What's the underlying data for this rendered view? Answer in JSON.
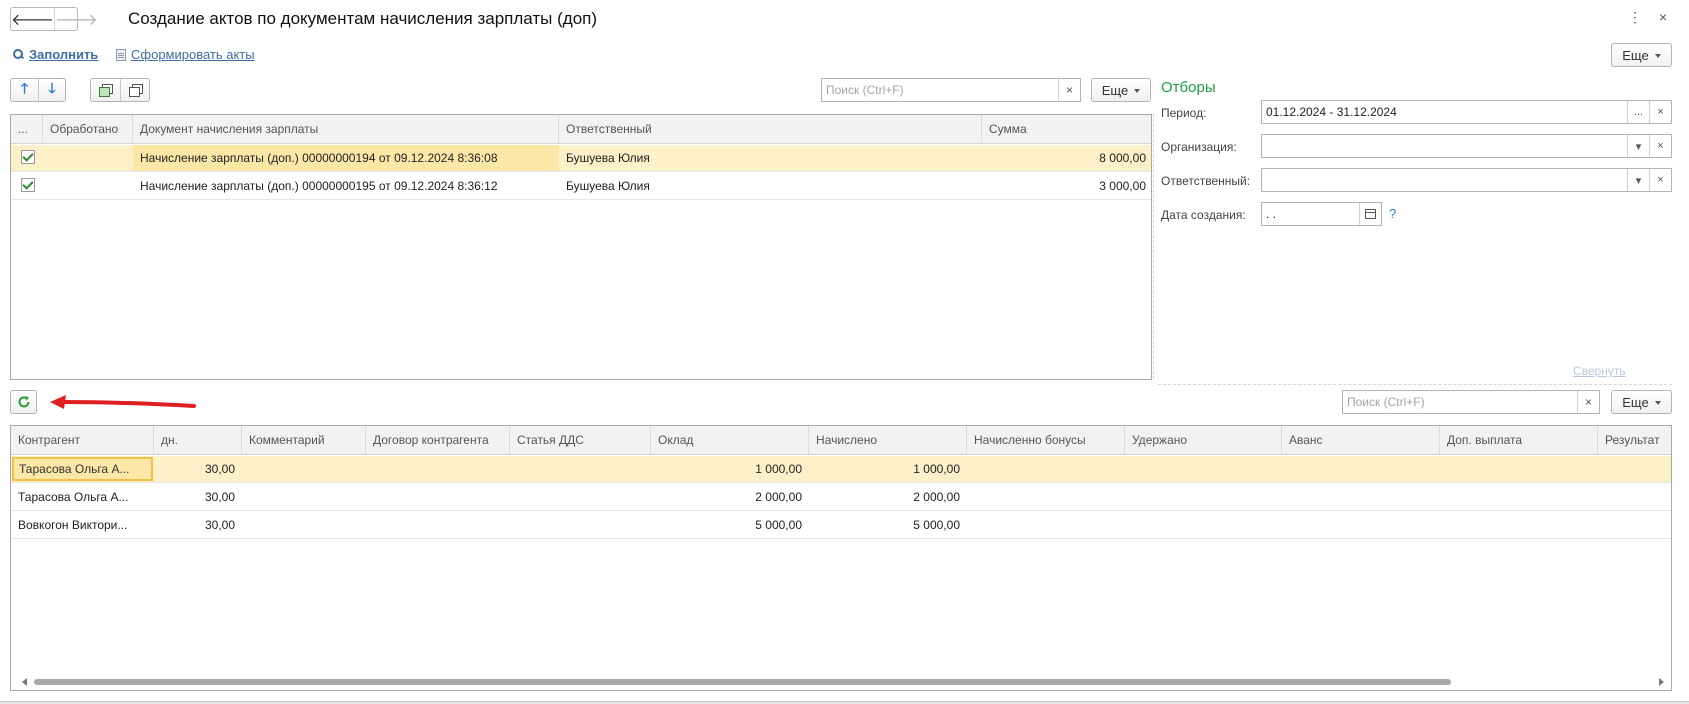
{
  "window": {
    "title": "Создание актов по документам начисления зарплаты (доп)",
    "nav_back": "🡐",
    "nav_forward": "🡒",
    "menu_icon": "⋮",
    "close_icon": "×"
  },
  "commands": {
    "fill": "Заполнить",
    "form_acts": "Сформировать акты",
    "more": "Еще"
  },
  "top_table": {
    "search_placeholder": "Поиск (Ctrl+F)",
    "clear": "×",
    "more": "Еще",
    "columns": [
      "...",
      "Обработано",
      "Документ начисления зарплаты",
      "Ответственный",
      "Сумма"
    ],
    "rows": [
      {
        "checked": true,
        "processed": "",
        "document": "Начисление зарплаты (доп.) 00000000194 от 09.12.2024 8:36:08",
        "responsible": "Бушуева Юлия",
        "sum": "8 000,00",
        "selected": true
      },
      {
        "checked": true,
        "processed": "",
        "document": "Начисление зарплаты (доп.) 00000000195 от 09.12.2024 8:36:12",
        "responsible": "Бушуева Юлия",
        "sum": "3 000,00",
        "selected": false
      }
    ]
  },
  "filters": {
    "title": "Отборы",
    "period_label": "Период:",
    "period_value": "01.12.2024 - 31.12.2024",
    "org_label": "Организация:",
    "org_value": "",
    "resp_label": "Ответственный:",
    "resp_value": "",
    "date_label": "Дата создания:",
    "date_value": " .  .",
    "help": "?",
    "collapse": "Свернуть",
    "ellipsis": "...",
    "clear": "×",
    "dropdown": "▾"
  },
  "bottom_table": {
    "search_placeholder": "Поиск (Ctrl+F)",
    "clear": "×",
    "more": "Еще",
    "columns": [
      "Контрагент",
      "дн.",
      "Комментарий",
      "Договор контрагента",
      "Статья ДДС",
      "Оклад",
      "Начислено",
      "Начисленно бонусы",
      "Удержано",
      "Аванс",
      "Доп. выплата",
      "Результат"
    ],
    "rows": [
      {
        "contractor": "Тарасова Ольга А...",
        "days": "30,00",
        "comment": "",
        "contract": "",
        "dds": "",
        "salary": "1 000,00",
        "accrued": "1 000,00",
        "bonus": "",
        "withheld": "",
        "advance": "",
        "extra": "",
        "result": "",
        "selected": true
      },
      {
        "contractor": "Тарасова Ольга А...",
        "days": "30,00",
        "comment": "",
        "contract": "",
        "dds": "",
        "salary": "2 000,00",
        "accrued": "2 000,00",
        "bonus": "",
        "withheld": "",
        "advance": "",
        "extra": "",
        "result": "",
        "selected": false
      },
      {
        "contractor": "Вовкогон Виктори...",
        "days": "30,00",
        "comment": "",
        "contract": "",
        "dds": "",
        "salary": "5 000,00",
        "accrued": "5 000,00",
        "bonus": "",
        "withheld": "",
        "advance": "",
        "extra": "",
        "result": "",
        "selected": false
      }
    ]
  },
  "colors": {
    "accent": "#3d6ea5",
    "filters_title": "#1f9e3a",
    "selected_row": "#fbf0c7",
    "arrow": "#e02020"
  }
}
